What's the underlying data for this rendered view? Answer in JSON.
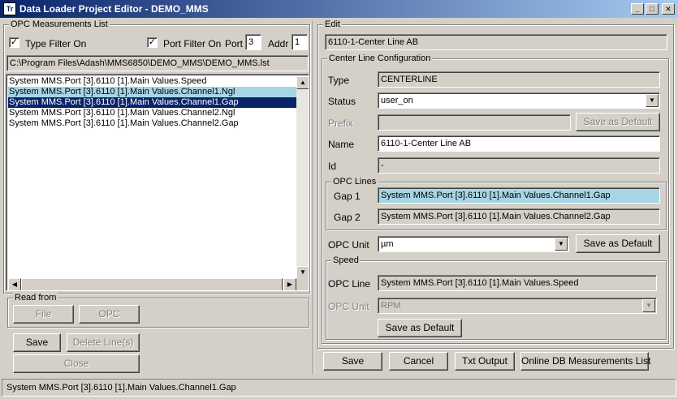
{
  "window": {
    "title": "Data Loader Project Editor - DEMO_MMS",
    "app_icon_text": "Tr",
    "minimize": "_",
    "maximize": "□",
    "close": "✕"
  },
  "opc_list": {
    "group_title": "OPC Measurements List",
    "type_filter_label": "Type Filter On",
    "type_filter_checked": "✓",
    "port_filter_label": "Port Filter On",
    "port_filter_checked": "✓",
    "port_label": "Port",
    "port_value": "3",
    "addr_label": "Addr",
    "addr_value": "1",
    "path": "C:\\Program Files\\Adash\\MMS6850\\DEMO_MMS\\DEMO_MMS.lst",
    "items": [
      "System MMS.Port [3].6110 [1].Main Values.Speed",
      "System MMS.Port [3].6110 [1].Main Values.Channel1.Ngl",
      "System MMS.Port [3].6110 [1].Main Values.Channel1.Gap",
      "System MMS.Port [3].6110 [1].Main Values.Channel2.Ngl",
      "System MMS.Port [3].6110 [1].Main Values.Channel2.Gap"
    ]
  },
  "read_from": {
    "group_title": "Read from",
    "file_button": "File",
    "opc_button": "OPC"
  },
  "left_actions": {
    "save": "Save",
    "delete_lines": "Delete Line(s)",
    "close": "Close"
  },
  "edit": {
    "group_title": "Edit",
    "header_value": "6110-1-Center Line AB",
    "config_title": "Center Line Configuration",
    "type_label": "Type",
    "type_value": "CENTERLINE",
    "status_label": "Status",
    "status_value": "user_on",
    "prefix_label": "Prefix",
    "prefix_value": "",
    "prefix_save_default": "Save as Default",
    "name_label": "Name",
    "name_value": "6110-1-Center Line AB",
    "id_label": "Id",
    "id_value": "-",
    "opc_lines_title": "OPC Lines",
    "gap1_label": "Gap 1",
    "gap1_value": "System MMS.Port [3].6110 [1].Main Values.Channel1.Gap",
    "gap2_label": "Gap 2",
    "gap2_value": "System MMS.Port [3].6110 [1].Main Values.Channel2.Gap",
    "opc_unit_label": "OPC Unit",
    "opc_unit_value": "µm",
    "opc_unit_save_default": "Save as Default",
    "speed_title": "Speed",
    "speed_opc_line_label": "OPC Line",
    "speed_opc_line_value": "System MMS.Port [3].6110 [1].Main Values.Speed",
    "speed_opc_unit_label": "OPC Unit",
    "speed_opc_unit_value": "RPM",
    "speed_save_default": "Save as Default"
  },
  "bottom_actions": {
    "save": "Save",
    "cancel": "Cancel",
    "txt_output": "Txt Output",
    "online_db": "Online DB Measurements List"
  },
  "status_bar": {
    "text": "System MMS.Port [3].6110 [1].Main Values.Channel1.Gap"
  },
  "icons": {
    "dropdown": "▼",
    "scroll_up": "▲",
    "scroll_down": "▼",
    "scroll_left": "◀",
    "scroll_right": "▶"
  }
}
